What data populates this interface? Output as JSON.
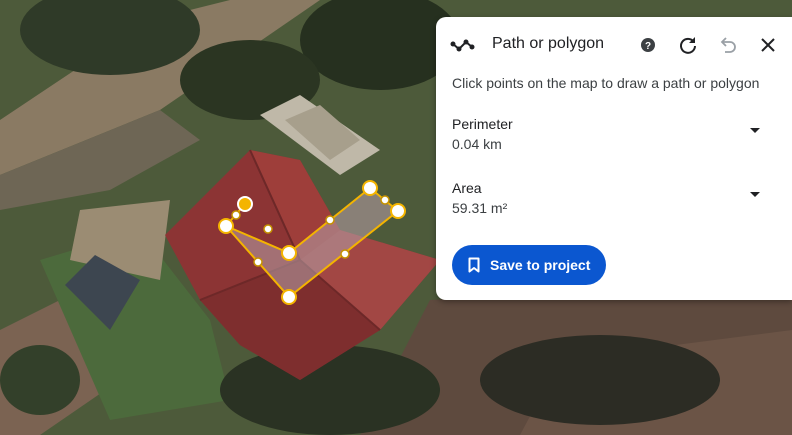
{
  "panel": {
    "title": "Path or polygon",
    "instructions": "Click points on the map to draw a path or polygon",
    "metrics": [
      {
        "label": "Perimeter",
        "value": "0.04 km"
      },
      {
        "label": "Area",
        "value": "59.31 m²"
      }
    ],
    "save_label": "Save to project",
    "icons": [
      "path-tool-icon",
      "help-icon",
      "redo-icon",
      "undo-icon",
      "close-icon"
    ]
  },
  "colors": {
    "accent": "#0b57d0",
    "polygon_stroke": "#f4b400",
    "polygon_fill": "#b39aa0"
  }
}
